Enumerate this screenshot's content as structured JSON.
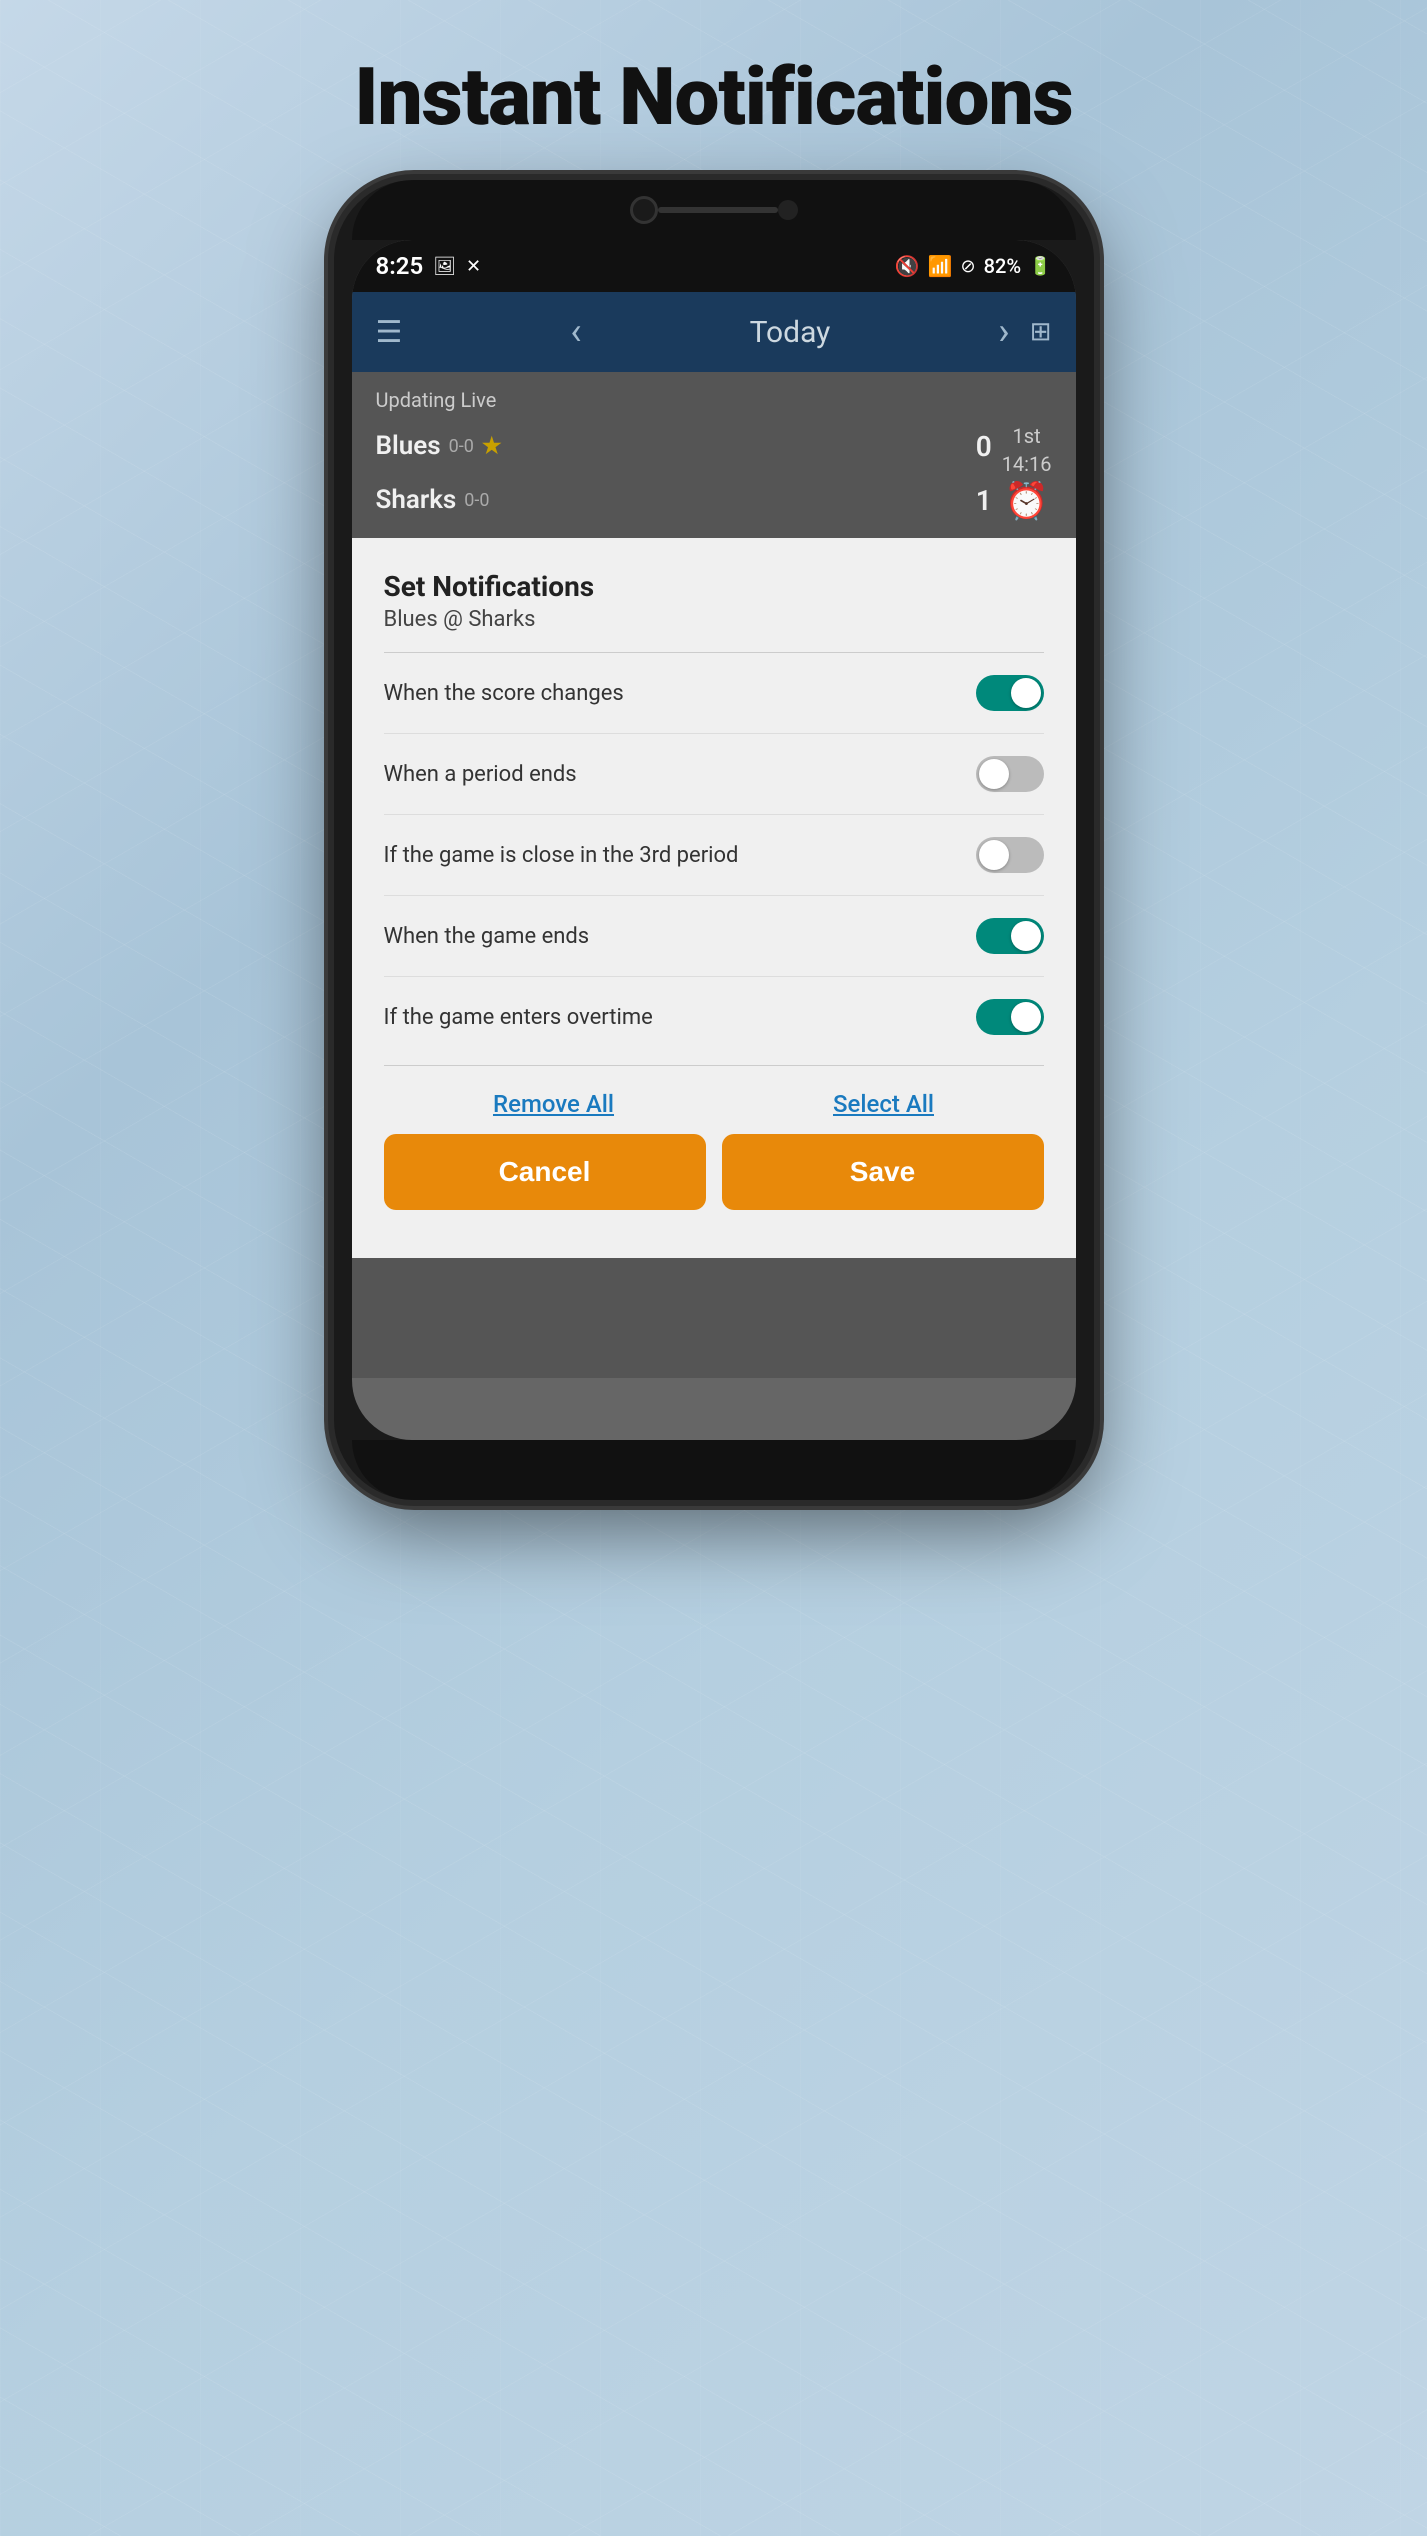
{
  "page": {
    "title": "Instant Notifications",
    "background_color": "#b8cfe0"
  },
  "status_bar": {
    "time": "8:25",
    "icons": [
      "photo",
      "close"
    ],
    "right_icons": [
      "mute",
      "wifi",
      "blocked",
      "battery"
    ],
    "battery_percent": "82%"
  },
  "app_header": {
    "menu_icon": "☰",
    "back_icon": "‹",
    "title": "Today",
    "forward_icon": "›",
    "settings_icon": "⊞"
  },
  "game": {
    "updating_live_label": "Updating Live",
    "team1": {
      "name": "Blues",
      "record": "0-0",
      "starred": true,
      "score": "0"
    },
    "team2": {
      "name": "Sharks",
      "record": "0-0",
      "score": "1"
    },
    "period": "1st",
    "time": "14:16"
  },
  "dialog": {
    "title": "Set Notifications",
    "subtitle": "Blues @ Sharks",
    "notifications": [
      {
        "label": "When the score changes",
        "enabled": true
      },
      {
        "label": "When a period ends",
        "enabled": false
      },
      {
        "label": "If the game is close in the 3rd period",
        "enabled": false
      },
      {
        "label": "When the game ends",
        "enabled": true
      },
      {
        "label": "If the game enters overtime",
        "enabled": true
      }
    ],
    "remove_all_label": "Remove All",
    "select_all_label": "Select All",
    "cancel_label": "Cancel",
    "save_label": "Save"
  }
}
